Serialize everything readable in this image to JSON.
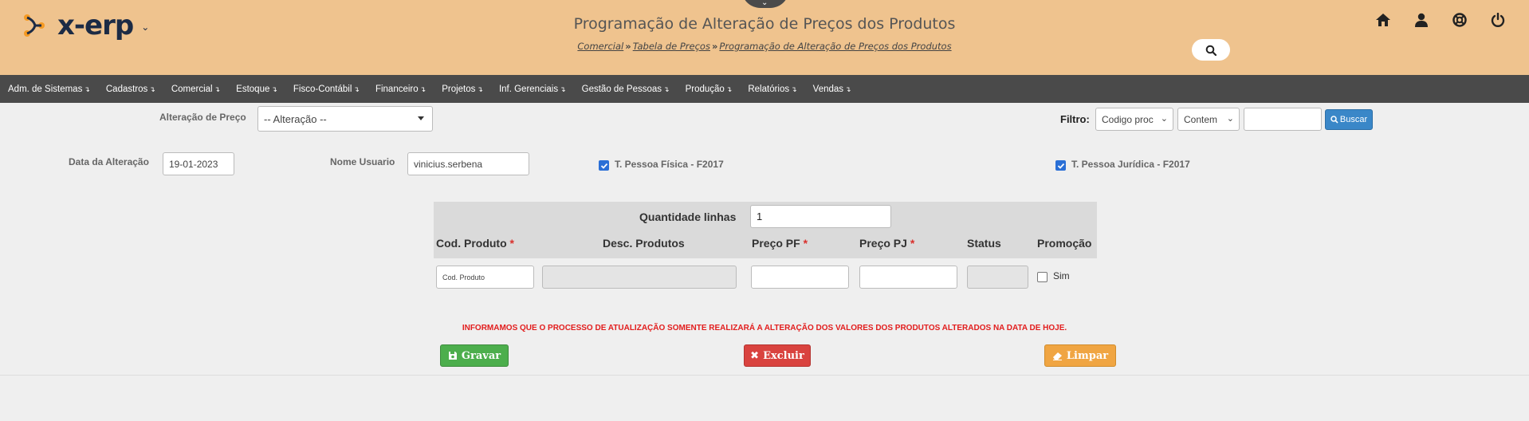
{
  "app": {
    "logo_text": "x-erp"
  },
  "header": {
    "title": "Programação de Alteração de Preços dos Produtos",
    "breadcrumb": [
      "Comercial",
      "Tabela de Preços",
      "Programação de Alteração de Preços dos Produtos"
    ],
    "breadcrumb_separator": "»"
  },
  "menu": [
    "Adm. de Sistemas",
    "Cadastros",
    "Comercial",
    "Estoque",
    "Fisco-Contábil",
    "Financeiro",
    "Projetos",
    "Inf. Gerenciais",
    "Gestão de Pessoas",
    "Produção",
    "Relatórios",
    "Vendas"
  ],
  "menu_arrow": "↴",
  "form": {
    "alteracao_label": "Alteração de Preço",
    "alteracao_value": "-- Alteração --",
    "filtro_label": "Filtro:",
    "filtro_field": "Codigo proc",
    "filtro_op": "Contem",
    "filtro_value": "",
    "buscar_label": "Buscar",
    "data_label": "Data da Alteração",
    "data_value": "19-01-2023",
    "usuario_label": "Nome Usuario",
    "usuario_value": "vinicius.serbena",
    "pf_label": "T. Pessoa Física - F2017",
    "pj_label": "T. Pessoa Jurídica - F2017"
  },
  "table": {
    "qtd_label": "Quantidade linhas",
    "qtd_value": "1",
    "columns": [
      "Cod. Produto",
      "Desc. Produtos",
      "Preço PF",
      "Preço PJ",
      "Status",
      "Promoção"
    ],
    "required_mark": "*",
    "row": {
      "cod_placeholder": "Cod. Produto",
      "promo_label": "Sim"
    }
  },
  "warning": "INFORMAMOS QUE O PROCESSO DE ATUALIZAÇÃO SOMENTE REALIZARÁ A ALTERAÇÃO DOS VALORES DOS PRODUTOS ALTERADOS NA DATA DE HOJE.",
  "buttons": {
    "gravar": "Gravar",
    "excluir": "Excluir",
    "limpar": "Limpar"
  },
  "colors": {
    "header_bg": "#efc38e",
    "menu_bg": "#4a4a4a",
    "accent_blue": "#3a87c8",
    "green": "#4cae4c",
    "red": "#d9433f",
    "orange": "#f0a542"
  }
}
